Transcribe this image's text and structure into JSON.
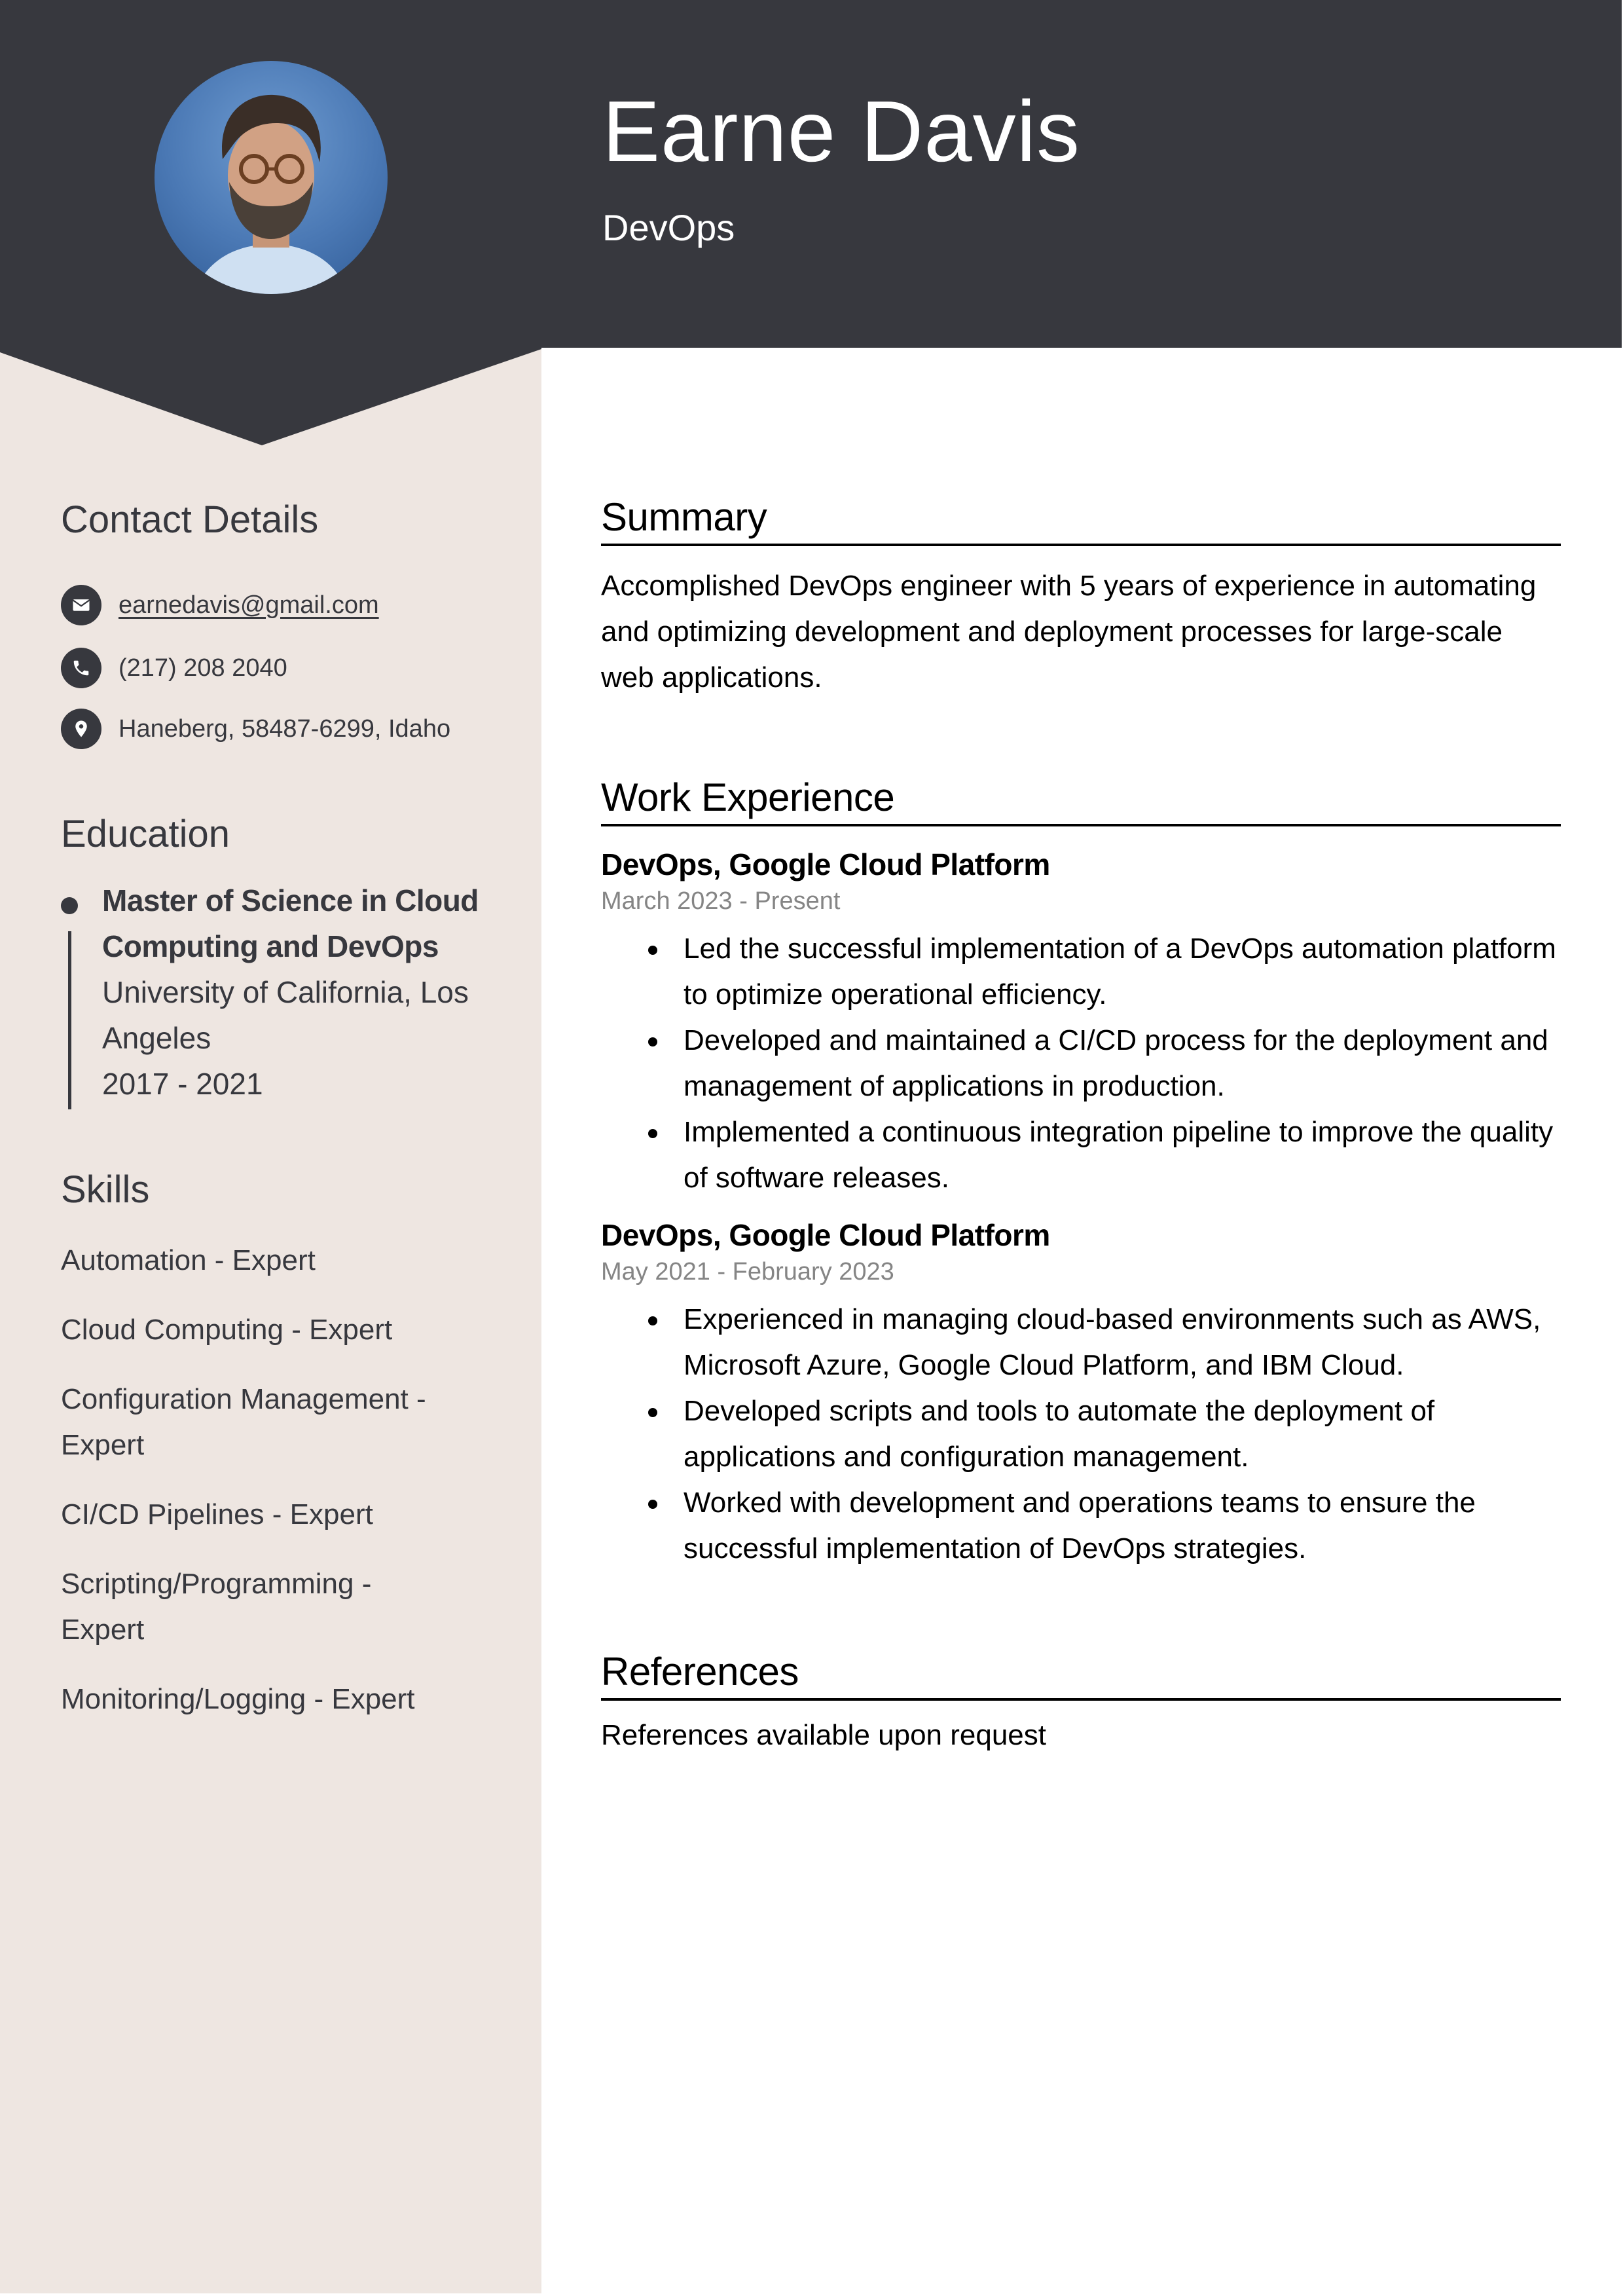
{
  "header": {
    "name": "Earne Davis",
    "title": "DevOps",
    "background_color": "#37383e",
    "avatar_alt": "profile-photo"
  },
  "sidebar": {
    "background_color": "#eee6e1",
    "contact": {
      "heading": "Contact Details",
      "items": [
        {
          "icon": "envelope-icon",
          "text": "earnedavis@gmail.com",
          "is_link": true
        },
        {
          "icon": "phone-icon",
          "text": "(217) 208 2040",
          "is_link": false
        },
        {
          "icon": "location-pin-icon",
          "text": "Haneberg, 58487-6299, Idaho",
          "is_link": false
        }
      ]
    },
    "education": {
      "heading": "Education",
      "entries": [
        {
          "degree": "Master of Science in Cloud Computing and DevOps",
          "school": "University of California, Los Angeles",
          "years": "2017 - 2021"
        }
      ]
    },
    "skills": {
      "heading": "Skills",
      "items": [
        "Automation - Expert",
        "Cloud Computing - Expert",
        "Configuration Management - Expert",
        "CI/CD Pipelines - Expert",
        "Scripting/Programming - Expert",
        "Monitoring/Logging - Expert"
      ]
    }
  },
  "main": {
    "summary": {
      "heading": "Summary",
      "text": "Accomplished DevOps engineer with 5 years of experience in automating and optimizing development and deployment processes for large-scale web applications."
    },
    "work": {
      "heading": "Work Experience",
      "jobs": [
        {
          "title": "DevOps, Google Cloud Platform",
          "dates": "March 2023 - Present",
          "bullets": [
            "Led the successful implementation of a DevOps automation platform to optimize operational efficiency.",
            "Developed and maintained a CI/CD process for the deployment and management of applications in production.",
            "Implemented a continuous integration pipeline to improve the quality of software releases."
          ]
        },
        {
          "title": "DevOps, Google Cloud Platform",
          "dates": "May 2021 - February 2023",
          "bullets": [
            "Experienced in managing cloud-based environments such as AWS, Microsoft Azure, Google Cloud Platform, and IBM Cloud.",
            "Developed scripts and tools to automate the deployment of applications and configuration management.",
            "Worked with development and operations teams to ensure the successful implementation of DevOps strategies."
          ]
        }
      ]
    },
    "references": {
      "heading": "References",
      "text": "References available upon request"
    }
  }
}
